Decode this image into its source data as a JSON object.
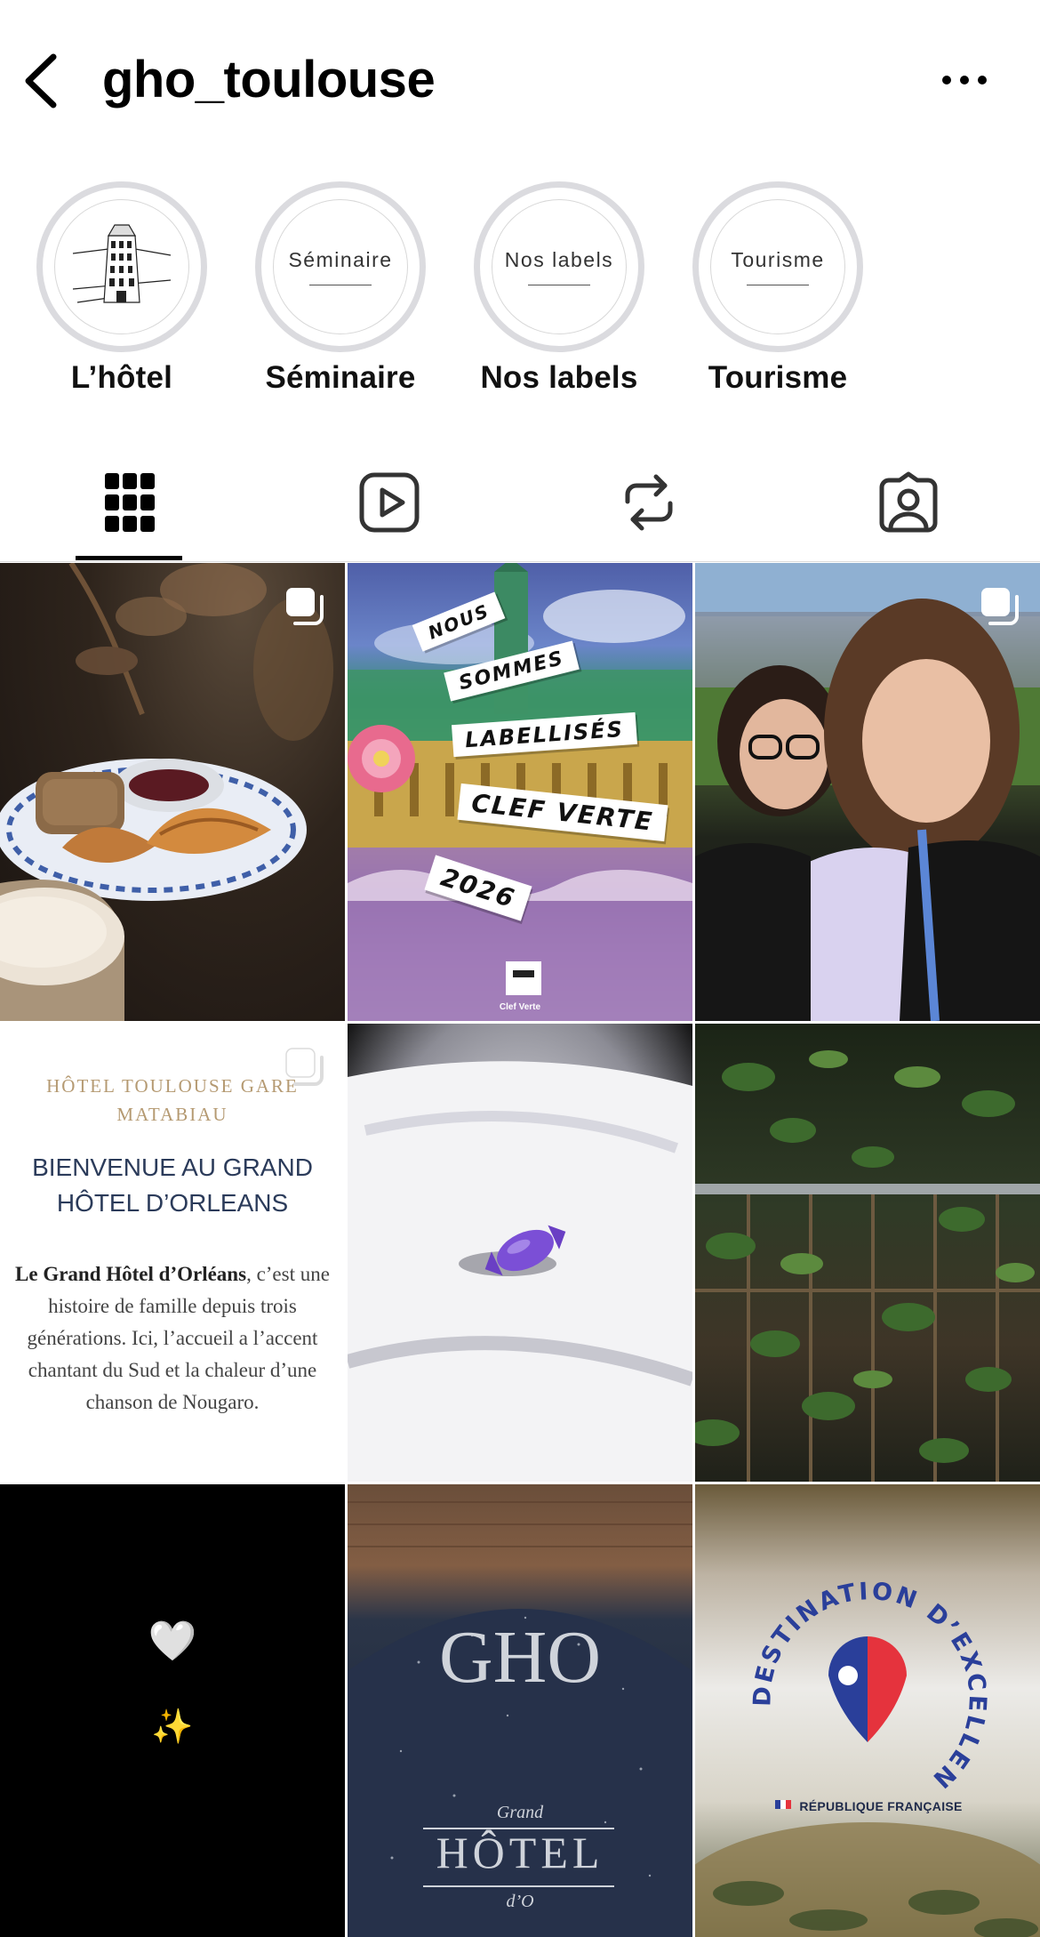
{
  "header": {
    "username": "gho_toulouse",
    "back_icon": "chevron-left-icon",
    "more_icon": "more-horizontal-icon"
  },
  "highlights": [
    {
      "label": "L’hôtel",
      "cover_text": "",
      "cover": "hotel-building-drawing"
    },
    {
      "label": "Séminaire",
      "cover_text": "Séminaire"
    },
    {
      "label": "Nos labels",
      "cover_text": "Nos labels"
    },
    {
      "label": "Tourisme",
      "cover_text": "Tourisme"
    }
  ],
  "tabs": [
    {
      "name": "posts",
      "icon": "grid-icon",
      "active": true
    },
    {
      "name": "reels",
      "icon": "reels-icon",
      "active": false
    },
    {
      "name": "reposts",
      "icon": "repost-icon",
      "active": false
    },
    {
      "name": "tagged",
      "icon": "tagged-icon",
      "active": false
    }
  ],
  "posts": {
    "clef": {
      "lines": [
        "NOUS",
        "SOMMES",
        "LABELLISÉS",
        "CLEF VERTE",
        "2026"
      ],
      "logo_text": "Clef Verte"
    },
    "welcome": {
      "top_line1": "HÔTEL TOULOUSE GARE",
      "top_line2": "MATABIAU",
      "title_line1": "BIENVENUE AU GRAND",
      "title_line2": "HÔTEL D’ORLEANS",
      "body_bold": "Le Grand Hôtel d’Orléans",
      "body_rest": ", c’est une histoire de famille depuis trois générations. Ici, l’accueil a l’accent chantant du Sud et la chaleur d’une chanson de Nougaro."
    },
    "dark": {
      "heart": "🤍",
      "sparkles": "✨"
    },
    "sign": {
      "monogram": "GHO",
      "script": "Grand",
      "word": "HÔTEL",
      "tail": "d’O"
    },
    "destination": {
      "arc_text": "DESTINATION D’EXCELLENCE",
      "republique": "RÉPUBLIQUE FRANÇAISE"
    }
  },
  "colors": {
    "text": "#000000",
    "ring": "#dbdbdf",
    "welcome_title": "#2b3b5a",
    "welcome_gold": "#b59a72",
    "marianne_blue": "#2a3f9a",
    "marianne_red": "#e5333d"
  }
}
